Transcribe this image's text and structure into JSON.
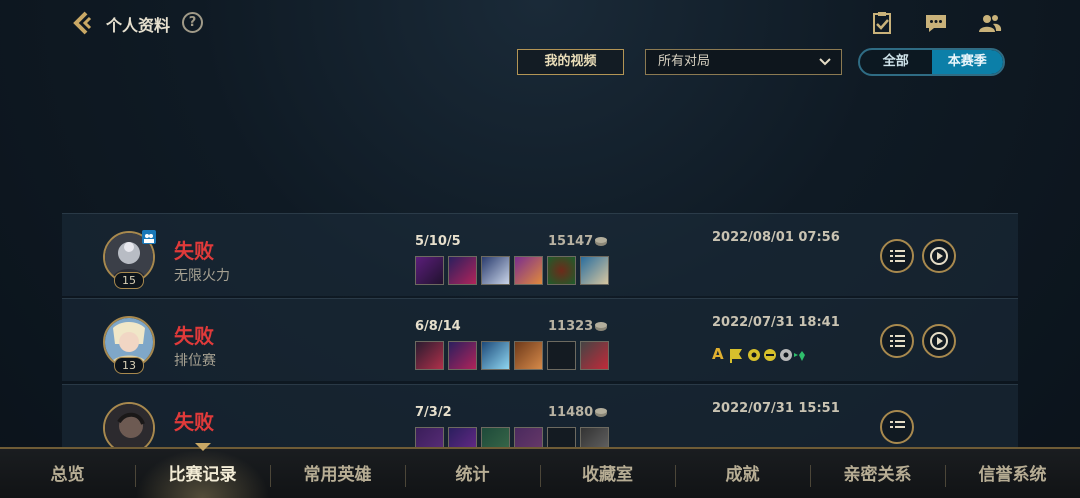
{
  "header": {
    "title": "个人资料",
    "help": "?"
  },
  "filters": {
    "my_videos": "我的视频",
    "match_type_selected": "所有对局",
    "season_toggle": [
      "全部",
      "本赛季"
    ],
    "season_toggle_active": "本赛季"
  },
  "matches": [
    {
      "result": "失败",
      "mode": "无限火力",
      "level": "15",
      "kda": "5/10/5",
      "gold": "15147",
      "datetime": "2022/08/01 07:56"
    },
    {
      "result": "失败",
      "mode": "排位赛",
      "level": "13",
      "kda": "6/8/14",
      "gold": "11323",
      "datetime": "2022/07/31 18:41",
      "badge_letter": "A"
    },
    {
      "result": "失败",
      "mode": "",
      "level": "",
      "kda": "7/3/2",
      "gold": "11480",
      "datetime": "2022/07/31 15:51"
    }
  ],
  "tabs": [
    "总览",
    "比赛记录",
    "常用英雄",
    "统计",
    "收藏室",
    "成就",
    "亲密关系",
    "信誉系统"
  ],
  "active_tab": "比赛记录",
  "colors": {
    "accent_gold": "#a8894e",
    "defeat_red": "#e03a3a",
    "toggle_blue": "#0c7fa8"
  }
}
